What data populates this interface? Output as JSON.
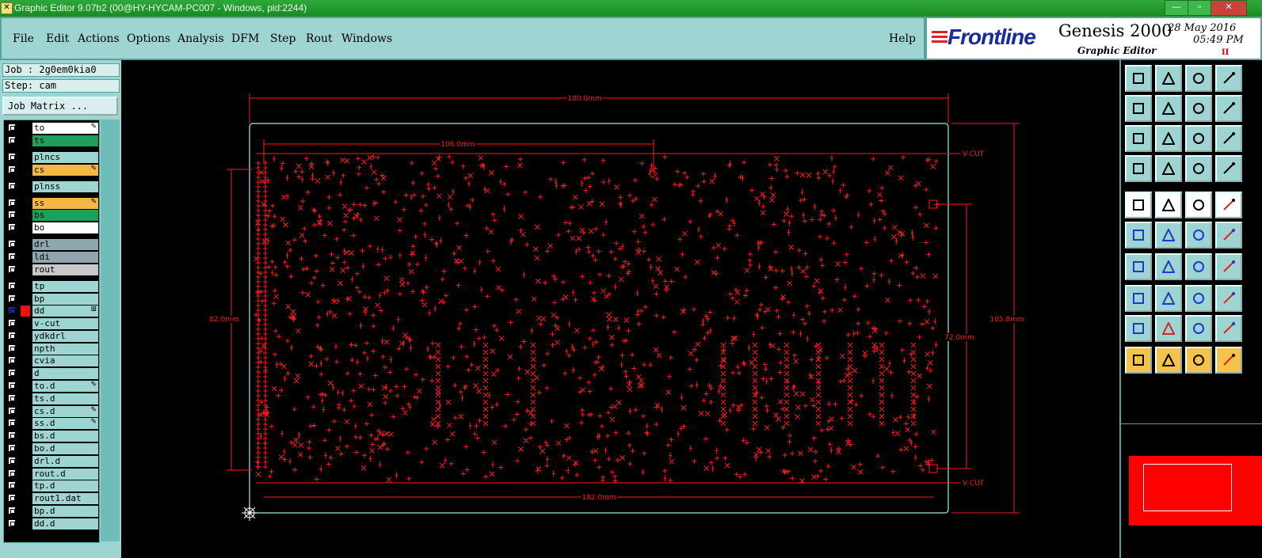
{
  "window": {
    "title": "Graphic Editor 9.07b2 (00@HY-HYCAM-PC007 - Windows, pid:2244)",
    "icon": "app-icon",
    "buttons": [
      "minimize",
      "maximize",
      "close"
    ]
  },
  "menu": {
    "items": [
      {
        "label": "File",
        "key": "file"
      },
      {
        "label": "Edit",
        "key": "edit"
      },
      {
        "label": "Actions",
        "key": "actions"
      },
      {
        "label": "Options",
        "key": "options"
      },
      {
        "label": "Analysis",
        "key": "analysis"
      },
      {
        "label": "DFM",
        "key": "dfm"
      },
      {
        "label": "Step",
        "key": "step"
      },
      {
        "label": "Rout",
        "key": "rout"
      },
      {
        "label": "Windows",
        "key": "windows"
      }
    ],
    "help": "Help"
  },
  "brand": {
    "logo": "Frontline",
    "product": "Genesis 2000",
    "subtitle": "Graphic Editor",
    "date": "28 May 2016",
    "time": "05:49 PM",
    "pause": "II"
  },
  "job": {
    "job_label": "Job : 2g0em0kia0",
    "step_label": "Step: cam",
    "matrix_button": "Job Matrix ..."
  },
  "layers": [
    {
      "name": "to",
      "color": "#ffffff",
      "mark": "✎"
    },
    {
      "name": "ts",
      "color": "#1fa05a",
      "mark": ""
    },
    {
      "name": "plncs",
      "color": "#9ed4d2",
      "mark": ""
    },
    {
      "name": "cs",
      "color": "#f5b743",
      "mark": "✎"
    },
    {
      "name": "plnss",
      "color": "#9ed4d2",
      "mark": ""
    },
    {
      "name": "ss",
      "color": "#f5b743",
      "mark": "✎"
    },
    {
      "name": "bs",
      "color": "#1fa05a",
      "mark": ""
    },
    {
      "name": "bo",
      "color": "#ffffff",
      "mark": ""
    },
    {
      "name": "drl",
      "color": "#8fa6ae",
      "mark": ""
    },
    {
      "name": "ldi",
      "color": "#8fa6ae",
      "mark": ""
    },
    {
      "name": "rout",
      "color": "#c8c8c8",
      "mark": ""
    },
    {
      "name": "tp",
      "color": "#9ed4d2",
      "mark": ""
    },
    {
      "name": "bp",
      "color": "#9ed4d2",
      "mark": ""
    },
    {
      "name": "dd",
      "color": "#9ed4d2",
      "mark": "⊞",
      "active": true
    },
    {
      "name": "v-cut",
      "color": "#9ed4d2",
      "mark": ""
    },
    {
      "name": "ydkdrl",
      "color": "#9ed4d2",
      "mark": ""
    },
    {
      "name": "npth",
      "color": "#9ed4d2",
      "mark": ""
    },
    {
      "name": "cvia",
      "color": "#9ed4d2",
      "mark": ""
    },
    {
      "name": "d",
      "color": "#9ed4d2",
      "mark": ""
    },
    {
      "name": "to.d",
      "color": "#9ed4d2",
      "mark": "✎"
    },
    {
      "name": "ts.d",
      "color": "#9ed4d2",
      "mark": ""
    },
    {
      "name": "cs.d",
      "color": "#9ed4d2",
      "mark": "✎"
    },
    {
      "name": "ss.d",
      "color": "#9ed4d2",
      "mark": "✎"
    },
    {
      "name": "bs.d",
      "color": "#9ed4d2",
      "mark": ""
    },
    {
      "name": "bo.d",
      "color": "#9ed4d2",
      "mark": ""
    },
    {
      "name": "drl.d",
      "color": "#9ed4d2",
      "mark": ""
    },
    {
      "name": "rout.d",
      "color": "#9ed4d2",
      "mark": ""
    },
    {
      "name": "tp.d",
      "color": "#9ed4d2",
      "mark": ""
    },
    {
      "name": "rout1.dat",
      "color": "#9ed4d2",
      "mark": ""
    },
    {
      "name": "bp.d",
      "color": "#9ed4d2",
      "mark": ""
    },
    {
      "name": "dd.d",
      "color": "#9ed4d2",
      "mark": ""
    }
  ],
  "drawing": {
    "dim_top": "180.0mm",
    "dim_inner_top": "106.0mm",
    "dim_bottom": "182.0mm",
    "dim_left": "82.0mm",
    "dim_right_inner": "72.0mm",
    "dim_right_outer": "105.8mm",
    "vcut_top": "V-CUT",
    "vcut_bottom": "V-CUT",
    "colors": {
      "feature": "#ff1a1a",
      "profile": "#9fe8e8"
    }
  },
  "tools": [
    [
      "home-up-icon",
      "home-down-icon",
      "home-icon",
      "window-icon"
    ],
    [
      "pan-left-icon",
      "pan-right-icon",
      "undo-icon",
      "redraw-icon"
    ],
    [
      "zoom-fit-icon",
      "zoom-area-icon",
      "one-to-one-icon",
      "help-icon"
    ],
    [
      "settings-icon",
      "grid-icon",
      "layers-icon",
      "layers-alt-icon"
    ],
    [
      "pad-icon",
      "line-icon",
      "ruler-icon",
      "circle-icon"
    ],
    [
      "node-icon",
      "cross-icon",
      "snap-icon",
      "snap-alt-icon"
    ],
    [
      "angle-icon",
      "slash-icon",
      "arc-icon",
      "split-icon"
    ],
    [
      "measure-icon",
      "minus-icon",
      "box-icon",
      "sq-icon"
    ],
    [
      "tri-icon",
      "tri2-icon",
      "tri3-icon",
      "tri4-icon"
    ],
    [
      "pointer-icon",
      "pointer-box-icon",
      "pointer-alt-icon",
      "connect-icon"
    ]
  ]
}
